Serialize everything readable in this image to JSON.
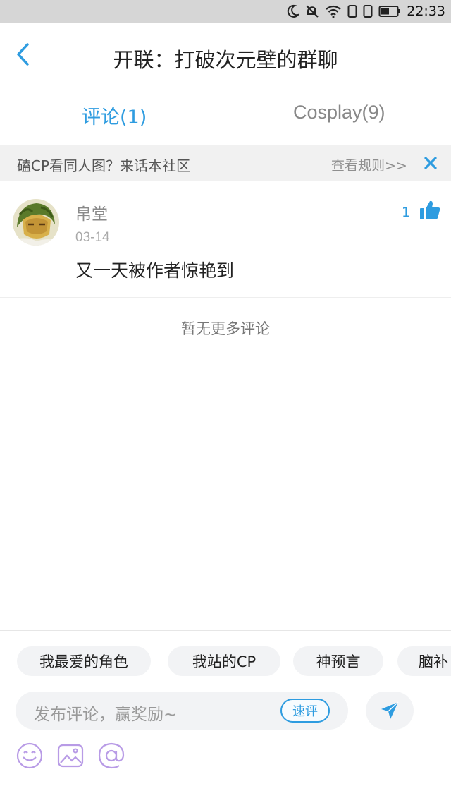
{
  "status_bar": {
    "time": "22:33"
  },
  "header": {
    "title": "开联：打破次元壁的群聊",
    "back_icon": "chevron-left-icon"
  },
  "tabs": [
    {
      "label": "评论(1)",
      "active": true
    },
    {
      "label": "Cosplay(9)",
      "active": false
    }
  ],
  "notice": {
    "text": "磕CP看同人图？来话本社区",
    "rules_link": "查看规则>>",
    "close_icon": "close-icon"
  },
  "comment": {
    "username": "帛堂",
    "date": "03-14",
    "text": "又一天被作者惊艳到",
    "like_count": "1"
  },
  "no_more": "暂无更多评论",
  "quick_chips": [
    "我最爱的角色",
    "我站的CP",
    "神预言",
    "脑补"
  ],
  "input": {
    "placeholder": "发布评论，赢奖励~",
    "quick_review_label": "速评"
  },
  "toolbar_icons": [
    "emoji-icon",
    "image-icon",
    "at-icon"
  ],
  "colors": {
    "accent": "#2e9ce0",
    "tool_purple": "#b89be6",
    "chip_bg": "#f2f3f5"
  }
}
